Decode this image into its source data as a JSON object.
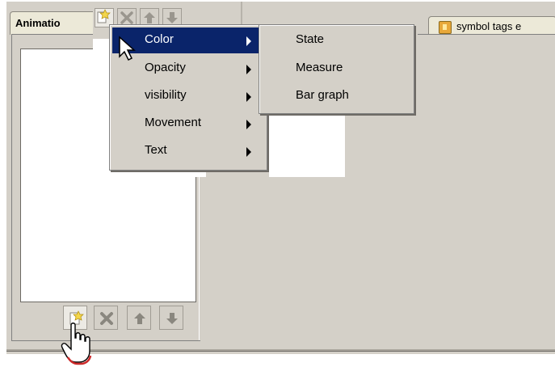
{
  "tabs": {
    "animation_label": "Animatio",
    "symbol_tags_label": "symbol tags e"
  },
  "context_menu": {
    "items": [
      {
        "label": "Color",
        "selected": true
      },
      {
        "label": "Opacity"
      },
      {
        "label": "visibility"
      },
      {
        "label": "Movement"
      },
      {
        "label": "Text"
      }
    ]
  },
  "color_submenu": {
    "items": [
      {
        "label": "State"
      },
      {
        "label": "Measure"
      },
      {
        "label": "Bar graph"
      }
    ]
  },
  "toolbar": {
    "icons": [
      "new-animation-icon",
      "delete-icon",
      "move-up-icon",
      "move-down-icon"
    ]
  },
  "colors": {
    "window_bg": "#d4d0c8",
    "menu_highlight": "#0a246a",
    "tab_bg": "#ece9d8"
  }
}
